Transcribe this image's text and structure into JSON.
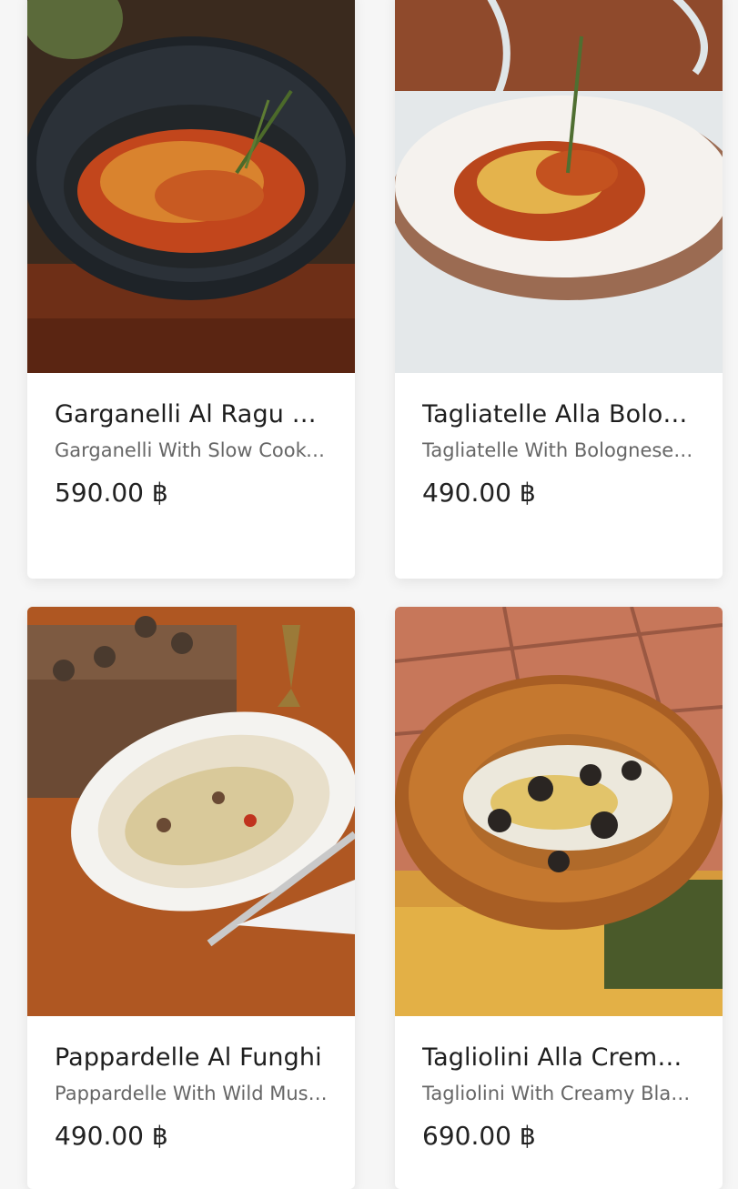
{
  "menu": {
    "items": [
      {
        "name": "Garganelli Al Ragu Di Manzo",
        "description": "Garganelli With Slow Cooked Beef Ragu",
        "price": "590.00 ฿"
      },
      {
        "name": "Tagliatelle Alla Bolognese",
        "description": "Tagliatelle With Bolognese Sauce",
        "price": "490.00 ฿"
      },
      {
        "name": "Pappardelle Al Funghi",
        "description": "Pappardelle With Wild Mushrooms",
        "price": "490.00 ฿"
      },
      {
        "name": "Tagliolini Alla Crema Di Tartufo",
        "description": "Tagliolini With Creamy Black Truffle",
        "price": "690.00 ฿"
      }
    ]
  }
}
